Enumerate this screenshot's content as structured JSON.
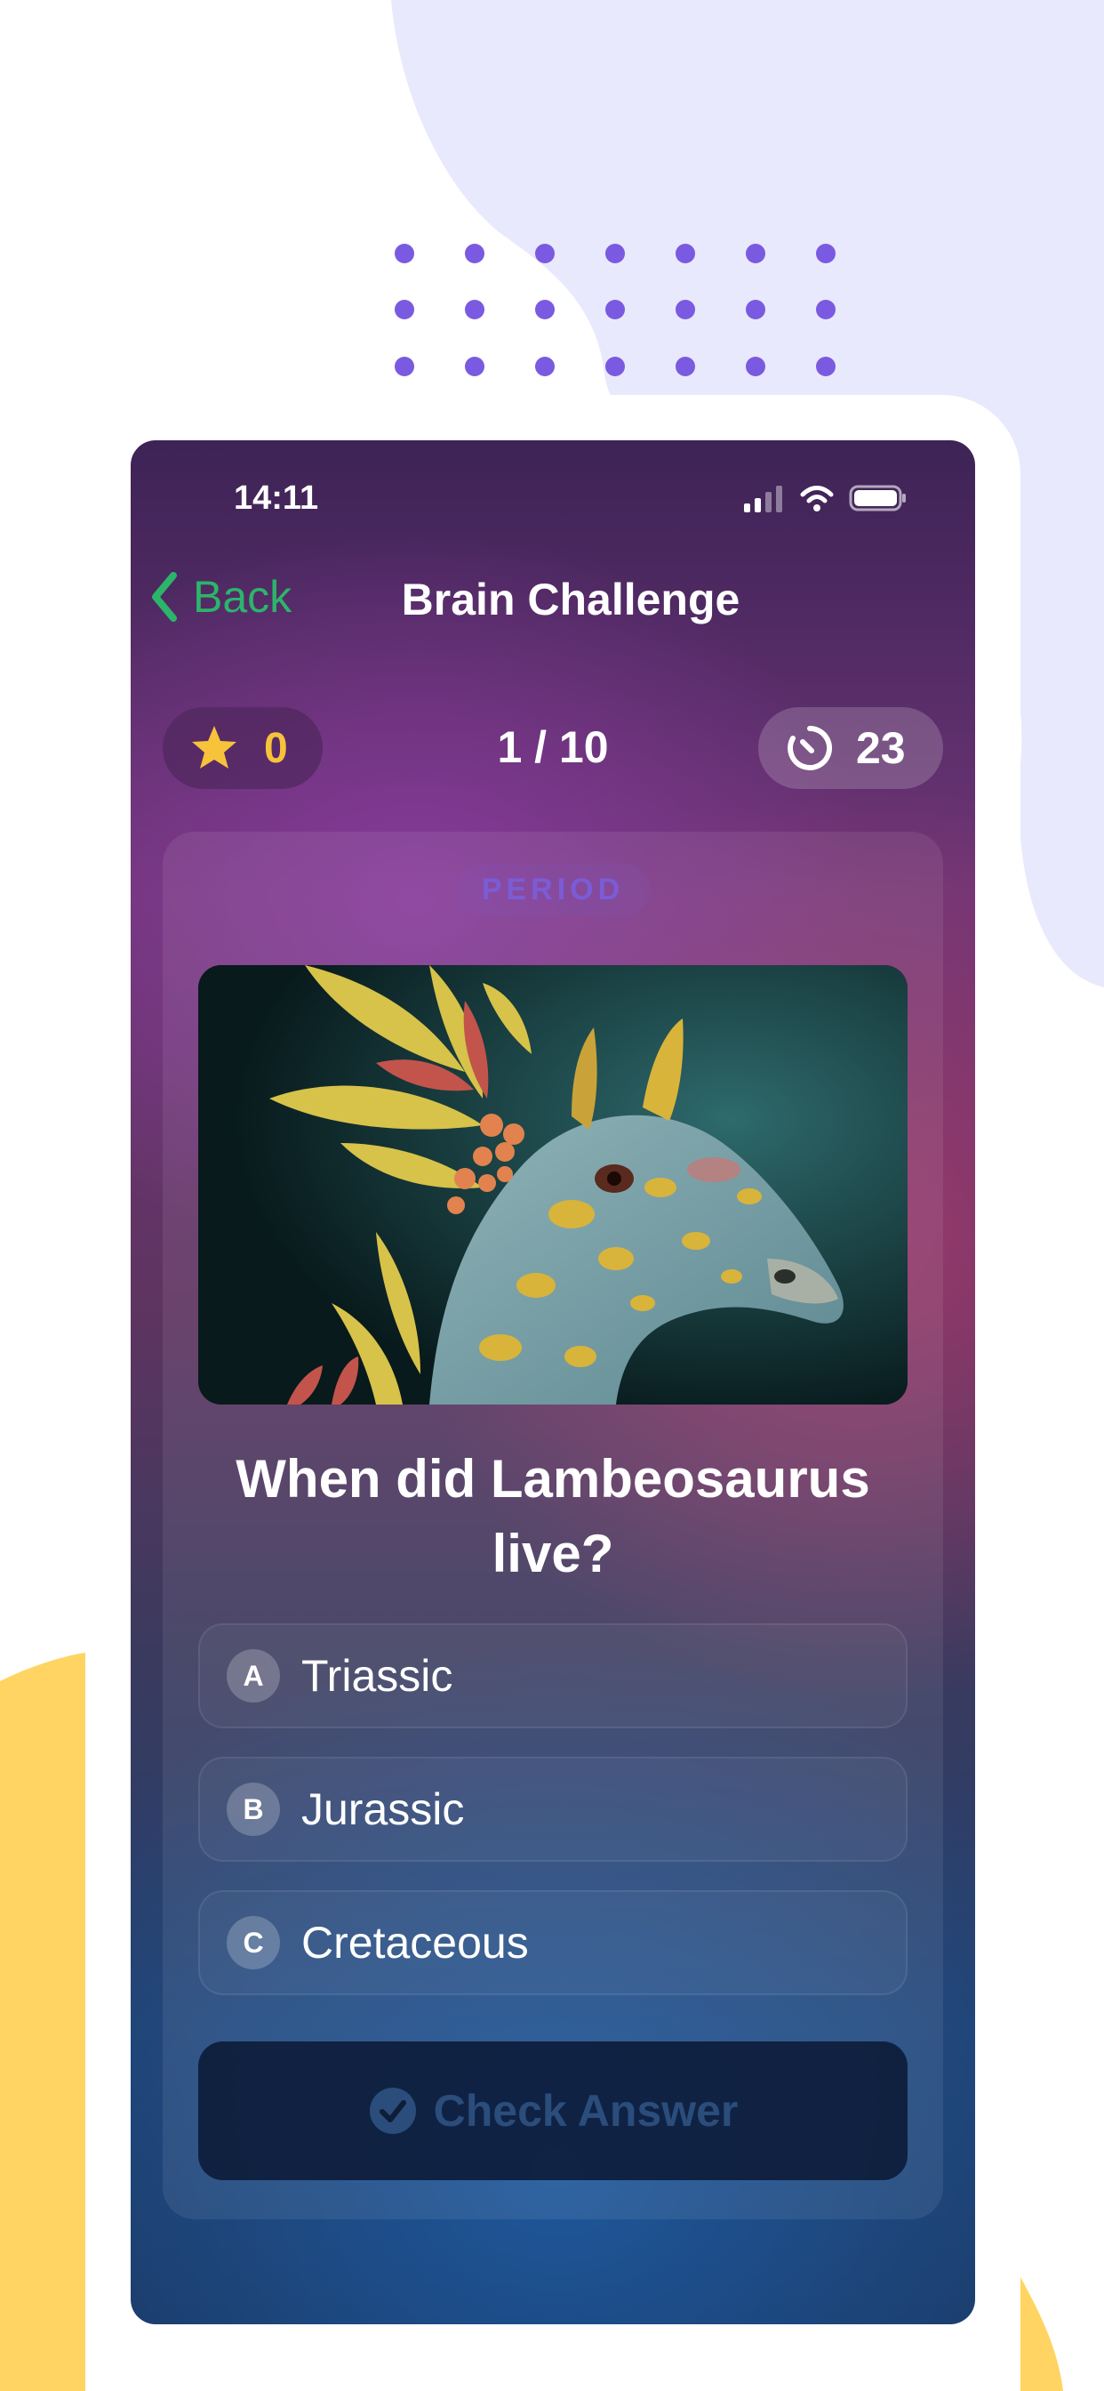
{
  "status_bar": {
    "time": "14:11"
  },
  "nav": {
    "back_label": "Back",
    "title": "Brain Challenge"
  },
  "stats": {
    "score": "0",
    "progress": "1 / 10",
    "timer": "23"
  },
  "question": {
    "category": "PERIOD",
    "image_icon": "lambeosaurus-illustration",
    "text": "When did Lambeosaurus live?",
    "options": [
      {
        "letter": "A",
        "text": "Triassic"
      },
      {
        "letter": "B",
        "text": "Jurassic"
      },
      {
        "letter": "C",
        "text": "Cretaceous"
      }
    ]
  },
  "actions": {
    "check_answer": "Check Answer"
  },
  "colors": {
    "accent_green": "#2bb56a",
    "score_yellow": "#f6c33a",
    "badge_purple": "#7b5cd6",
    "bg_lavender": "#e9e9fd",
    "bg_yellow": "#ffd462"
  }
}
